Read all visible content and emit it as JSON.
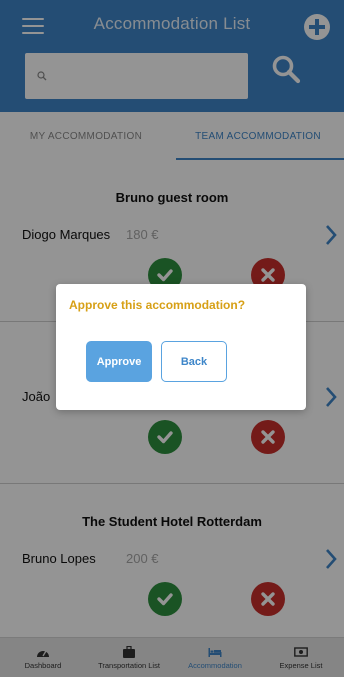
{
  "header": {
    "title": "Accommodation List",
    "search_placeholder": "",
    "icons": {
      "menu": "hamburger-menu-icon",
      "add": "plus-circle-icon",
      "search": "search-icon"
    }
  },
  "tabs": [
    {
      "label": "MY ACCOMMODATION",
      "active": false
    },
    {
      "label": "TEAM ACCOMMODATION",
      "active": true
    }
  ],
  "accommodations": [
    {
      "title": "Bruno guest room",
      "name": "Diogo Marques",
      "price": "180 €"
    },
    {
      "title": "",
      "name": "João",
      "price": ""
    },
    {
      "title": "The Student Hotel Rotterdam",
      "name": "Bruno Lopes",
      "price": "200 €"
    }
  ],
  "dialog": {
    "title": "Approve this accommodation?",
    "approve_label": "Approve",
    "back_label": "Back"
  },
  "bottom_nav": [
    {
      "label": "Dashboard",
      "icon": "dashboard-gauge-icon",
      "active": false
    },
    {
      "label": "Transportation List",
      "icon": "suitcase-icon",
      "active": false
    },
    {
      "label": "Accommodation",
      "icon": "bed-icon",
      "active": true
    },
    {
      "label": "Expense List",
      "icon": "money-bill-icon",
      "active": false
    }
  ],
  "colors": {
    "primary": "#3e86c9",
    "approve_green": "#2e8f3e",
    "reject_red": "#c9302c",
    "dialog_title": "#d7a016",
    "approve_button": "#5aa3e0"
  }
}
